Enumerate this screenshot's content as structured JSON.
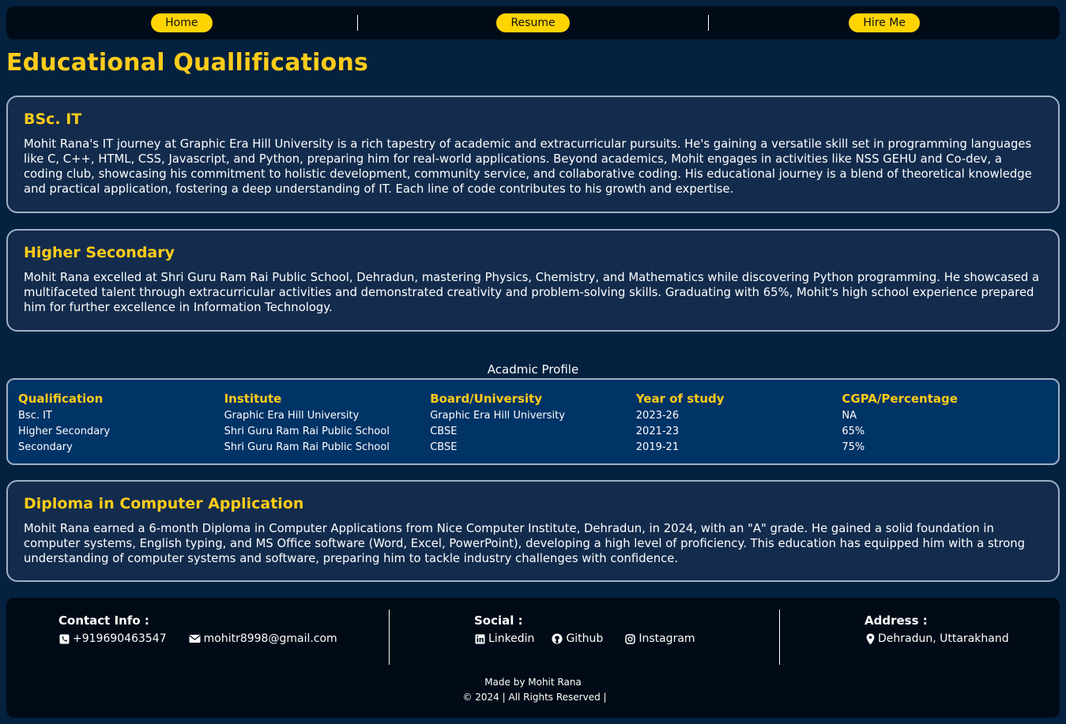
{
  "nav": {
    "items": [
      {
        "label": "Home"
      },
      {
        "label": "Resume"
      },
      {
        "label": "Hire Me"
      }
    ]
  },
  "page": {
    "title": "Educational Quallifications"
  },
  "cards": [
    {
      "title": "BSc. IT",
      "text": "Mohit Rana's IT journey at Graphic Era Hill University is a rich tapestry of academic and extracurricular pursuits. He's gaining a versatile skill set in programming languages like C, C++, HTML, CSS, Javascript, and Python, preparing him for real-world applications. Beyond academics, Mohit engages in activities like NSS GEHU and Co-dev, a coding club, showcasing his commitment to holistic development, community service, and collaborative coding. His educational journey is a blend of theoretical knowledge and practical application, fostering a deep understanding of IT. Each line of code contributes to his growth and expertise."
    },
    {
      "title": "Higher Secondary",
      "text": "Mohit Rana excelled at Shri Guru Ram Rai Public School, Dehradun, mastering Physics, Chemistry, and Mathematics while discovering Python programming. He showcased a multifaceted talent through extracurricular activities and demonstrated creativity and problem-solving skills. Graduating with 65%, Mohit's high school experience prepared him for further excellence in Information Technology."
    },
    {
      "title": "Diploma in Computer Application",
      "text": "Mohit Rana earned a 6-month Diploma in Computer Applications from Nice Computer Institute, Dehradun, in 2024, with an \"A\" grade. He gained a solid foundation in computer systems, English typing, and MS Office software (Word, Excel, PowerPoint), developing a high level of proficiency. This education has equipped him with a strong understanding of computer systems and software, preparing him to tackle industry challenges with confidence."
    }
  ],
  "profile_table": {
    "caption": "Acadmic Profile",
    "headers": [
      "Qualification",
      "Institute",
      "Board/University",
      "Year of study",
      "CGPA/Percentage"
    ],
    "rows": [
      [
        "Bsc. IT",
        "Graphic Era Hill University",
        "Graphic Era Hill University",
        "2023-26",
        "NA"
      ],
      [
        "Higher Secondary",
        "Shri Guru Ram Rai Public School",
        "CBSE",
        "2021-23",
        "65%"
      ],
      [
        "Secondary",
        "Shri Guru Ram Rai Public School",
        "CBSE",
        "2019-21",
        "75%"
      ]
    ]
  },
  "footer": {
    "contact": {
      "heading": "Contact Info :",
      "phone": "+919690463547",
      "email": "mohitr8998@gmail.com"
    },
    "social": {
      "heading": "Social :",
      "linkedin": "Linkedin",
      "github": "Github",
      "instagram": "Instagram"
    },
    "address": {
      "heading": "Address :",
      "location": "Dehradun, Uttarakhand"
    },
    "made_by": "Made by Mohit Rana",
    "copyright": "© 2024 | All Rights Reserved |"
  },
  "colors": {
    "background": "#04213f",
    "accent": "#ffcc1a",
    "nav_button": "#ffd400",
    "card": "#132c4d",
    "table": "#003366",
    "footer": "#010b17"
  }
}
